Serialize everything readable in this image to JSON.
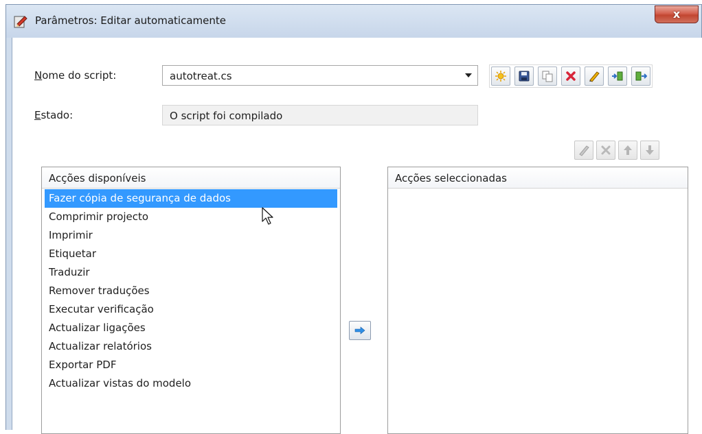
{
  "window": {
    "title": "Parâmetros: Editar automaticamente",
    "close_label": "x"
  },
  "form": {
    "script_name_label_accesskey": "N",
    "script_name_label_rest": "ome do script:",
    "script_name_value": "autotreat.cs",
    "state_label_accesskey": "E",
    "state_label_rest": "stado:",
    "state_value": "O script foi compilado"
  },
  "toolbar_icons": [
    "new-icon",
    "save-icon",
    "copy-icon",
    "delete-icon",
    "edit-icon",
    "import-icon",
    "export-icon"
  ],
  "actions_toolbar_icons": [
    "edit-action-icon",
    "remove-action-icon",
    "move-up-icon",
    "move-down-icon"
  ],
  "available": {
    "header": "Acções disponíveis",
    "items": [
      "Fazer cópia de segurança de dados",
      "Comprimir projecto",
      "Imprimir",
      "Etiquetar",
      "Traduzir",
      "Remover traduções",
      "Executar verificação",
      "Actualizar ligações",
      "Actualizar relatórios",
      "Exportar PDF",
      "Actualizar vistas do modelo"
    ],
    "selected_index": 0
  },
  "selected": {
    "header": "Acções seleccionadas",
    "items": []
  },
  "colors": {
    "selection": "#3399ff",
    "window_frame": "#cfdcec",
    "close_button": "#c24631"
  }
}
